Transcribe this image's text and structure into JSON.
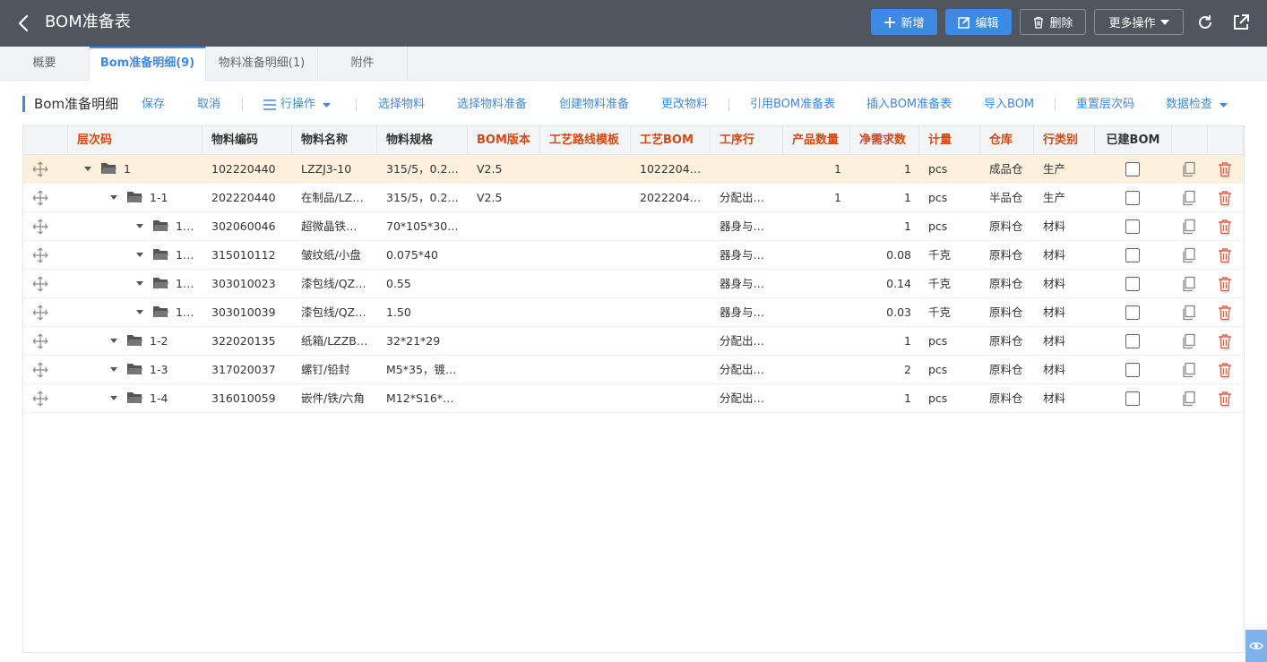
{
  "header": {
    "title": "BOM准备表",
    "add_label": "新增",
    "edit_label": "编辑",
    "delete_label": "删除",
    "more_label": "更多操作"
  },
  "tabs": [
    {
      "label": "概要"
    },
    {
      "label": "Bom准备明细(9)"
    },
    {
      "label": "物料准备明细(1)"
    },
    {
      "label": "附件"
    }
  ],
  "toolbar": {
    "section_title": "Bom准备明细",
    "save": "保存",
    "cancel": "取消",
    "row_ops": "行操作",
    "select_material": "选择物料",
    "select_material_prep": "选择物料准备",
    "create_material_prep": "创建物料准备",
    "change_material": "更改物料",
    "ref_bom": "引用BOM准备表",
    "insert_bom": "插入BOM准备表",
    "import_bom": "导入BOM",
    "reset_level": "重置层次码",
    "data_check": "数据检查"
  },
  "table": {
    "columns": [
      {
        "label": "层次码",
        "required": true
      },
      {
        "label": "物料编码",
        "required": false
      },
      {
        "label": "物料名称",
        "required": false
      },
      {
        "label": "物料规格",
        "required": false
      },
      {
        "label": "BOM版本",
        "required": true
      },
      {
        "label": "工艺路线模板",
        "required": true
      },
      {
        "label": "工艺BOM",
        "required": true
      },
      {
        "label": "工序行",
        "required": true
      },
      {
        "label": "产品数量",
        "required": true
      },
      {
        "label": "净需求数",
        "required": true
      },
      {
        "label": "计量",
        "required": true
      },
      {
        "label": "仓库",
        "required": true
      },
      {
        "label": "行类别",
        "required": true
      },
      {
        "label": "已建BOM",
        "required": false
      }
    ],
    "rows": [
      {
        "level": "1",
        "depth": 0,
        "code": "102220440",
        "name": "LZZJ3-10",
        "spec": "315/5，0.2…",
        "bom_version": "V2.5",
        "route": "",
        "process_bom": "1022204…",
        "process_line": "",
        "product_qty": "1",
        "net_qty": "1",
        "unit": "pcs",
        "warehouse": "成品仓",
        "row_type": "生产",
        "selected": true
      },
      {
        "level": "1-1",
        "depth": 1,
        "code": "202220440",
        "name": "在制品/LZ…",
        "spec": "315/5，0.2…",
        "bom_version": "V2.5",
        "route": "",
        "process_bom": "2022204…",
        "process_line": "分配出…",
        "product_qty": "1",
        "net_qty": "1",
        "unit": "pcs",
        "warehouse": "半品仓",
        "row_type": "生产",
        "selected": false
      },
      {
        "level": "1…",
        "depth": 2,
        "code": "302060046",
        "name": "超微晶铁…",
        "spec": "70*105*30/…",
        "bom_version": "",
        "route": "",
        "process_bom": "",
        "process_line": "器身与…",
        "product_qty": "",
        "net_qty": "1",
        "unit": "pcs",
        "warehouse": "原料仓",
        "row_type": "材料",
        "selected": false
      },
      {
        "level": "1…",
        "depth": 2,
        "code": "315010112",
        "name": "皱纹纸/小盘",
        "spec": "0.075*40",
        "bom_version": "",
        "route": "",
        "process_bom": "",
        "process_line": "器身与…",
        "product_qty": "",
        "net_qty": "0.08",
        "unit": "千克",
        "warehouse": "原料仓",
        "row_type": "材料",
        "selected": false
      },
      {
        "level": "1…",
        "depth": 2,
        "code": "303010023",
        "name": "漆包线/QZ…",
        "spec": "0.55",
        "bom_version": "",
        "route": "",
        "process_bom": "",
        "process_line": "器身与…",
        "product_qty": "",
        "net_qty": "0.14",
        "unit": "千克",
        "warehouse": "原料仓",
        "row_type": "材料",
        "selected": false
      },
      {
        "level": "1…",
        "depth": 2,
        "code": "303010039",
        "name": "漆包线/QZ…",
        "spec": "1.50",
        "bom_version": "",
        "route": "",
        "process_bom": "",
        "process_line": "器身与…",
        "product_qty": "",
        "net_qty": "0.03",
        "unit": "千克",
        "warehouse": "原料仓",
        "row_type": "材料",
        "selected": false
      },
      {
        "level": "1-2",
        "depth": 1,
        "code": "322020135",
        "name": "纸箱/LZZB…",
        "spec": "32*21*29",
        "bom_version": "",
        "route": "",
        "process_bom": "",
        "process_line": "分配出…",
        "product_qty": "",
        "net_qty": "1",
        "unit": "pcs",
        "warehouse": "原料仓",
        "row_type": "材料",
        "selected": false
      },
      {
        "level": "1-3",
        "depth": 1,
        "code": "317020037",
        "name": "螺钉/铅封",
        "spec": "M5*35，镀…",
        "bom_version": "",
        "route": "",
        "process_bom": "",
        "process_line": "分配出…",
        "product_qty": "",
        "net_qty": "2",
        "unit": "pcs",
        "warehouse": "原料仓",
        "row_type": "材料",
        "selected": false
      },
      {
        "level": "1-4",
        "depth": 1,
        "code": "316010059",
        "name": "嵌件/铁/六角",
        "spec": "M12*S16*2…",
        "bom_version": "",
        "route": "",
        "process_bom": "",
        "process_line": "分配出…",
        "product_qty": "",
        "net_qty": "1",
        "unit": "pcs",
        "warehouse": "原料仓",
        "row_type": "材料",
        "selected": false
      }
    ]
  },
  "colors": {
    "header_bg": "#50565f",
    "primary": "#3e8ae2",
    "required_header": "#d9480f",
    "selected_row": "#fdf0dd",
    "delete_icon": "#e8604c"
  },
  "icons": [
    "back-arrow-icon",
    "plus-icon",
    "edit-icon",
    "trash-icon",
    "caret-down-icon",
    "refresh-icon",
    "open-external-icon",
    "list-icon",
    "move-icon",
    "folder-open-icon",
    "copy-icon",
    "delete-icon",
    "eye-icon"
  ]
}
